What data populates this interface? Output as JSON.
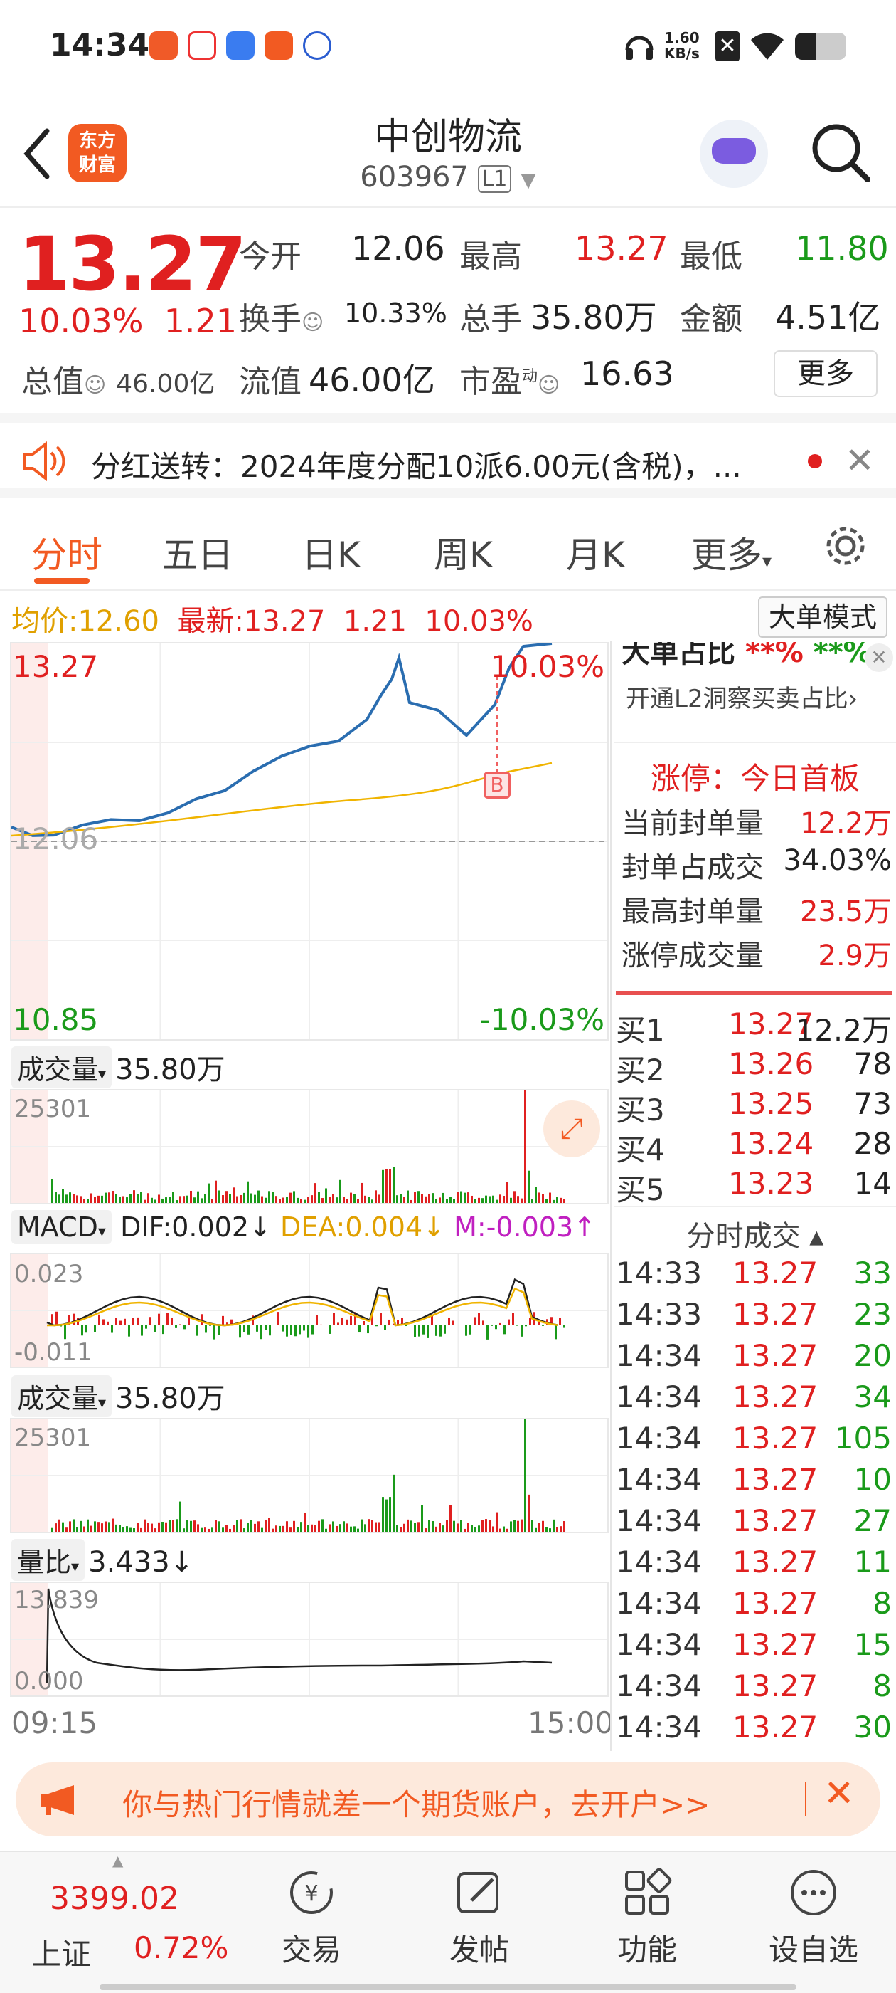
{
  "status_bar": {
    "time": "14:34",
    "net_speed_value": "1.60",
    "net_speed_unit": "KB/s"
  },
  "header": {
    "title": "中创物流",
    "code": "603967",
    "level_badge": "L1",
    "logo_line1": "东方",
    "logo_line2": "财富"
  },
  "quote": {
    "price": "13.27",
    "change_pct": "10.03%",
    "change_amt": "1.21",
    "open_label": "今开",
    "open": "12.06",
    "high_label": "最高",
    "high": "13.27",
    "low_label": "最低",
    "low": "11.80",
    "turnover_label": "换手",
    "turnover": "10.33%",
    "volume_label": "总手",
    "volume": "35.80万",
    "amount_label": "金额",
    "amount": "4.51亿",
    "mcap_label": "总值",
    "mcap": "46.00亿",
    "float_label": "流值",
    "float_cap": "46.00亿",
    "pe_label": "市盈",
    "pe_sup": "动",
    "pe": "16.63",
    "more_label": "更多"
  },
  "notice": {
    "text": "分红送转：2024年度分配10派6.00元(含税)，..."
  },
  "tabs": [
    "分时",
    "五日",
    "日K",
    "周K",
    "月K",
    "更多"
  ],
  "chart_info": {
    "avg_label": "均价:",
    "avg": "12.60",
    "latest_label": "最新:",
    "latest": "13.27",
    "latest_chg": "1.21",
    "latest_pct": "10.03%",
    "mode_btn": "大单模式",
    "y_top": "13.27",
    "y_mid": "12.06",
    "y_bottom": "10.85",
    "pct_top": "10.03%",
    "pct_bottom": "-10.03%",
    "b_marker": "B",
    "start_time": "09:15",
    "end_time": "15:00"
  },
  "volume_panel": {
    "label": "成交量",
    "value": "35.80万",
    "scale": "25301"
  },
  "macd_panel": {
    "label": "MACD",
    "dif": "DIF:0.002",
    "dea": "DEA:0.004",
    "m": "M:-0.003",
    "top": "0.023",
    "bottom": "-0.011"
  },
  "volume_panel2": {
    "label": "成交量",
    "value": "35.80万",
    "scale": "25301"
  },
  "ratio_panel": {
    "label": "量比",
    "value": "3.433",
    "top": "13.839",
    "bottom": "0.000"
  },
  "right_panel": {
    "big_order_title": "大单占比",
    "big_order_v1": "**%",
    "big_order_v2": "**%",
    "l2_link": "开通L2洞察买卖占比",
    "limit_title": "涨停：今日首板",
    "stats": [
      {
        "label": "当前封单量",
        "value": "12.2万"
      },
      {
        "label": "封单占成交",
        "value": "34.03%"
      },
      {
        "label": "最高封单量",
        "value": "23.5万"
      },
      {
        "label": "涨停成交量",
        "value": "2.9万"
      }
    ],
    "orderbook": [
      {
        "label": "买1",
        "price": "13.27",
        "vol": "12.2万"
      },
      {
        "label": "买2",
        "price": "13.26",
        "vol": "78"
      },
      {
        "label": "买3",
        "price": "13.25",
        "vol": "73"
      },
      {
        "label": "买4",
        "price": "13.24",
        "vol": "28"
      },
      {
        "label": "买5",
        "price": "13.23",
        "vol": "14"
      }
    ],
    "trades_title": "分时成交",
    "trades": [
      {
        "time": "14:33",
        "price": "13.27",
        "vol": "33"
      },
      {
        "time": "14:33",
        "price": "13.27",
        "vol": "23"
      },
      {
        "time": "14:34",
        "price": "13.27",
        "vol": "20"
      },
      {
        "time": "14:34",
        "price": "13.27",
        "vol": "34"
      },
      {
        "time": "14:34",
        "price": "13.27",
        "vol": "105"
      },
      {
        "time": "14:34",
        "price": "13.27",
        "vol": "10"
      },
      {
        "time": "14:34",
        "price": "13.27",
        "vol": "27"
      },
      {
        "time": "14:34",
        "price": "13.27",
        "vol": "11"
      },
      {
        "time": "14:34",
        "price": "13.27",
        "vol": "8"
      },
      {
        "time": "14:34",
        "price": "13.27",
        "vol": "15"
      },
      {
        "time": "14:34",
        "price": "13.27",
        "vol": "8"
      },
      {
        "time": "14:34",
        "price": "13.27",
        "vol": "30"
      }
    ]
  },
  "banner": {
    "text": "你与热门行情就差一个期货账户，去开户>>"
  },
  "bottom_nav": {
    "index_value": "3399.02",
    "index_name": "上证",
    "index_pct": "0.72%",
    "items": [
      "交易",
      "发帖",
      "功能",
      "设自选"
    ]
  },
  "colors": {
    "up": "#e02020",
    "down": "#1a9a1a",
    "accent": "#f25a22",
    "price_line": "#2a6db0",
    "avg_line": "#f0b400"
  }
}
